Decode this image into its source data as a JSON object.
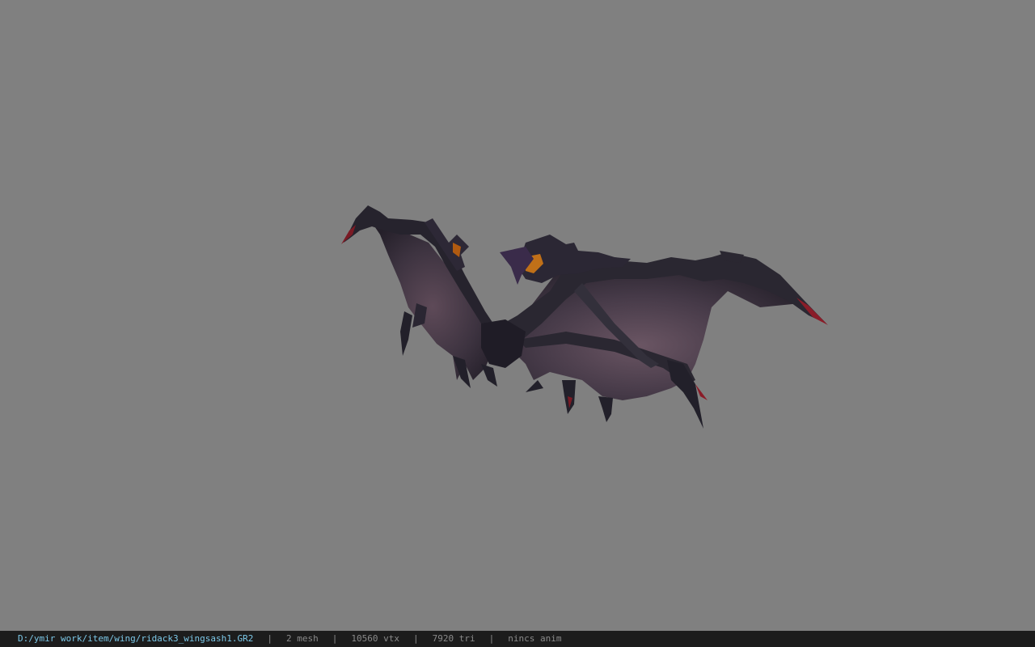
{
  "viewport": {
    "background": "#808080",
    "model": "dark bat-wing mesh"
  },
  "status_bar": {
    "file_path": "D:/ymir work/item/wing/ridack3_wingsash1.GR2",
    "mesh_count": "2 mesh",
    "vertex_count": "10560 vtx",
    "triangle_count": "7920 tri",
    "anim_status": "nincs anim",
    "separator": "|",
    "path_color": "#7cc8e8",
    "text_color": "#8a8a8a"
  }
}
